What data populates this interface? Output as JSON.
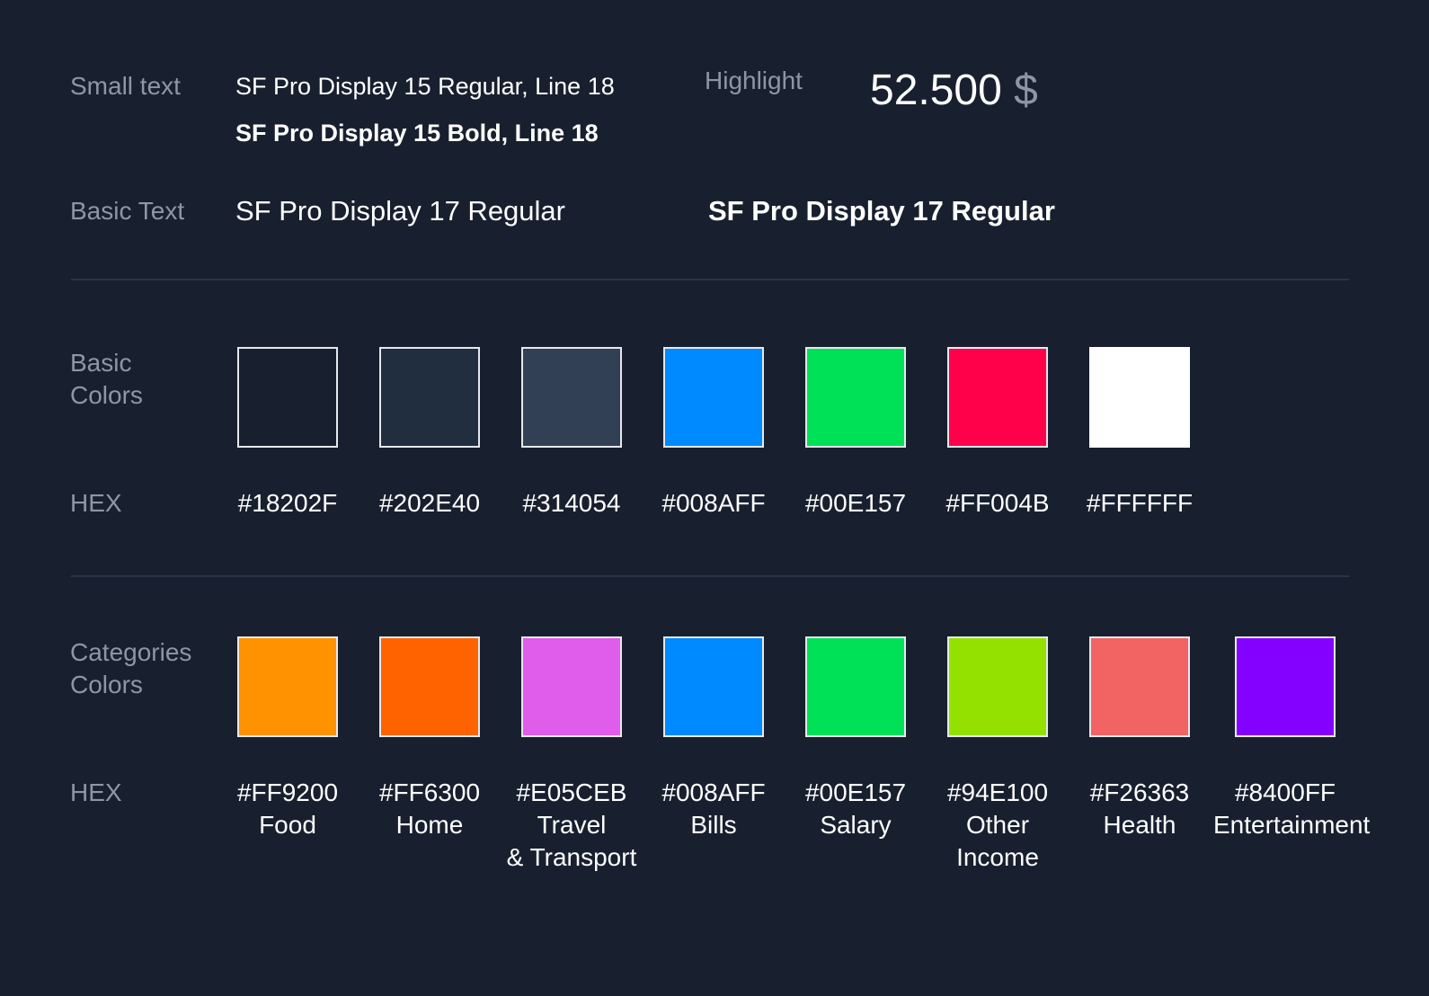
{
  "typography": {
    "small_text_label": "Small text",
    "small_regular_spec": "SF Pro Display 15 Regular, Line 18",
    "small_bold_spec": "SF Pro Display 15 Bold, Line 18",
    "highlight_label": "Highlight",
    "highlight_amount": "52.500",
    "highlight_currency": "$",
    "basic_text_label": "Basic Text",
    "basic_regular_spec": "SF Pro Display 17 Regular",
    "basic_bold_spec": "SF Pro Display 17 Regular"
  },
  "basic_colors": {
    "label": "Basic\nColors",
    "hex_label": "HEX",
    "swatches": [
      {
        "hex": "#18202F",
        "color": "#18202F"
      },
      {
        "hex": "#202E40",
        "color": "#202E40"
      },
      {
        "hex": "#314054",
        "color": "#314054"
      },
      {
        "hex": "#008AFF",
        "color": "#008AFF"
      },
      {
        "hex": "#00E157",
        "color": "#00E157"
      },
      {
        "hex": "#FF004B",
        "color": "#FF004B"
      },
      {
        "hex": "#FFFFFF",
        "color": "#FFFFFF"
      }
    ]
  },
  "category_colors": {
    "label": "Categories\nColors",
    "hex_label": "HEX",
    "swatches": [
      {
        "hex": "#FF9200",
        "color": "#FF9200",
        "name": "Food"
      },
      {
        "hex": "#FF6300",
        "color": "#FF6300",
        "name": "Home"
      },
      {
        "hex": "#E05CEB",
        "color": "#E05CEB",
        "name": "Travel\n& Transport"
      },
      {
        "hex": "#008AFF",
        "color": "#008AFF",
        "name": "Bills"
      },
      {
        "hex": "#00E157",
        "color": "#00E157",
        "name": "Salary"
      },
      {
        "hex": "#94E100",
        "color": "#94E100",
        "name": "Other\nIncome"
      },
      {
        "hex": "#F26363",
        "color": "#F26363",
        "name": "Health"
      },
      {
        "hex": "#8400FF",
        "color": "#8400FF",
        "name": "Entertainment"
      }
    ]
  }
}
